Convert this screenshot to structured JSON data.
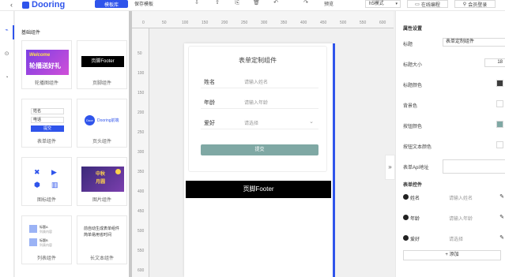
{
  "topbar": {
    "back_icon": "arrow-left",
    "logo_text": "Dooring",
    "template_lib": "模板库",
    "save_template": "保存模板",
    "preview": "预览",
    "mode": "h5模式",
    "online_code": "在线编程",
    "member_login": "会员登录"
  },
  "left_rail": [
    "layout-icon",
    "play-circle-icon",
    "clock-icon"
  ],
  "library": {
    "title": "基础组件",
    "cards": [
      {
        "label": "轮播图组件",
        "thumb": {
          "text1": "Welcome",
          "text2": "轮播送好礼"
        }
      },
      {
        "label": "页脚组件",
        "thumb": {
          "text1": "页脚Footer"
        }
      },
      {
        "label": "表单组件",
        "thumb": {
          "text1": "姓名",
          "text2": "电话",
          "text3": "提交"
        }
      },
      {
        "label": "页头组件",
        "thumb": {
          "text1": "Door",
          "text2": "Dooring前端"
        }
      },
      {
        "label": "图标组件",
        "thumb": {}
      },
      {
        "label": "图片组件",
        "thumb": {
          "text1": "中秋",
          "text2": "月圆"
        }
      },
      {
        "label": "列表组件",
        "thumb": {
          "text1": "标题A",
          "text2": "列表内容",
          "text3": "标题B",
          "text4": "列表内容"
        }
      },
      {
        "label": "长文本组件",
        "thumb": {
          "text1": "前自动生成表单组件简单易用省时间"
        }
      }
    ]
  },
  "canvas": {
    "ruler_h": [
      "0",
      "50",
      "100",
      "150",
      "200",
      "250",
      "300",
      "350",
      "400",
      "450",
      "500",
      "550",
      "600"
    ],
    "ruler_v": [
      "50",
      "100",
      "150",
      "200",
      "250",
      "300",
      "350",
      "400",
      "450",
      "500",
      "550",
      "600"
    ],
    "form": {
      "title": "表单定制组件",
      "rows": [
        {
          "label": "姓名",
          "placeholder": "请输入姓名"
        },
        {
          "label": "年龄",
          "placeholder": "请输入年龄"
        },
        {
          "label": "爱好",
          "placeholder": "请选择"
        }
      ],
      "submit": "提交"
    },
    "footer": "页脚Footer"
  },
  "props": {
    "title": "属性设置",
    "fields": {
      "title_label": "标题",
      "title_value": "表单定制组件",
      "title_size_label": "标题大小",
      "title_size_value": "18",
      "title_color_label": "标题颜色",
      "bg_color_label": "背景色",
      "btn_color_label": "按钮颜色",
      "btn_text_color_label": "按钮文本颜色",
      "api_label": "表单Api地址",
      "api_value": ""
    },
    "colors": {
      "title": "#3c3c3c",
      "bg": "#ffffff",
      "btn": "#7fa8a4",
      "btn_text": "#ffffff"
    },
    "controls_title": "表单控件",
    "controls": [
      {
        "name": "姓名",
        "placeholder": "请输入姓名"
      },
      {
        "name": "年龄",
        "placeholder": "请输入年龄"
      },
      {
        "name": "爱好",
        "placeholder": "请选择"
      }
    ],
    "add": "+ 添加"
  },
  "colors": {
    "accent": "#2f54eb"
  }
}
